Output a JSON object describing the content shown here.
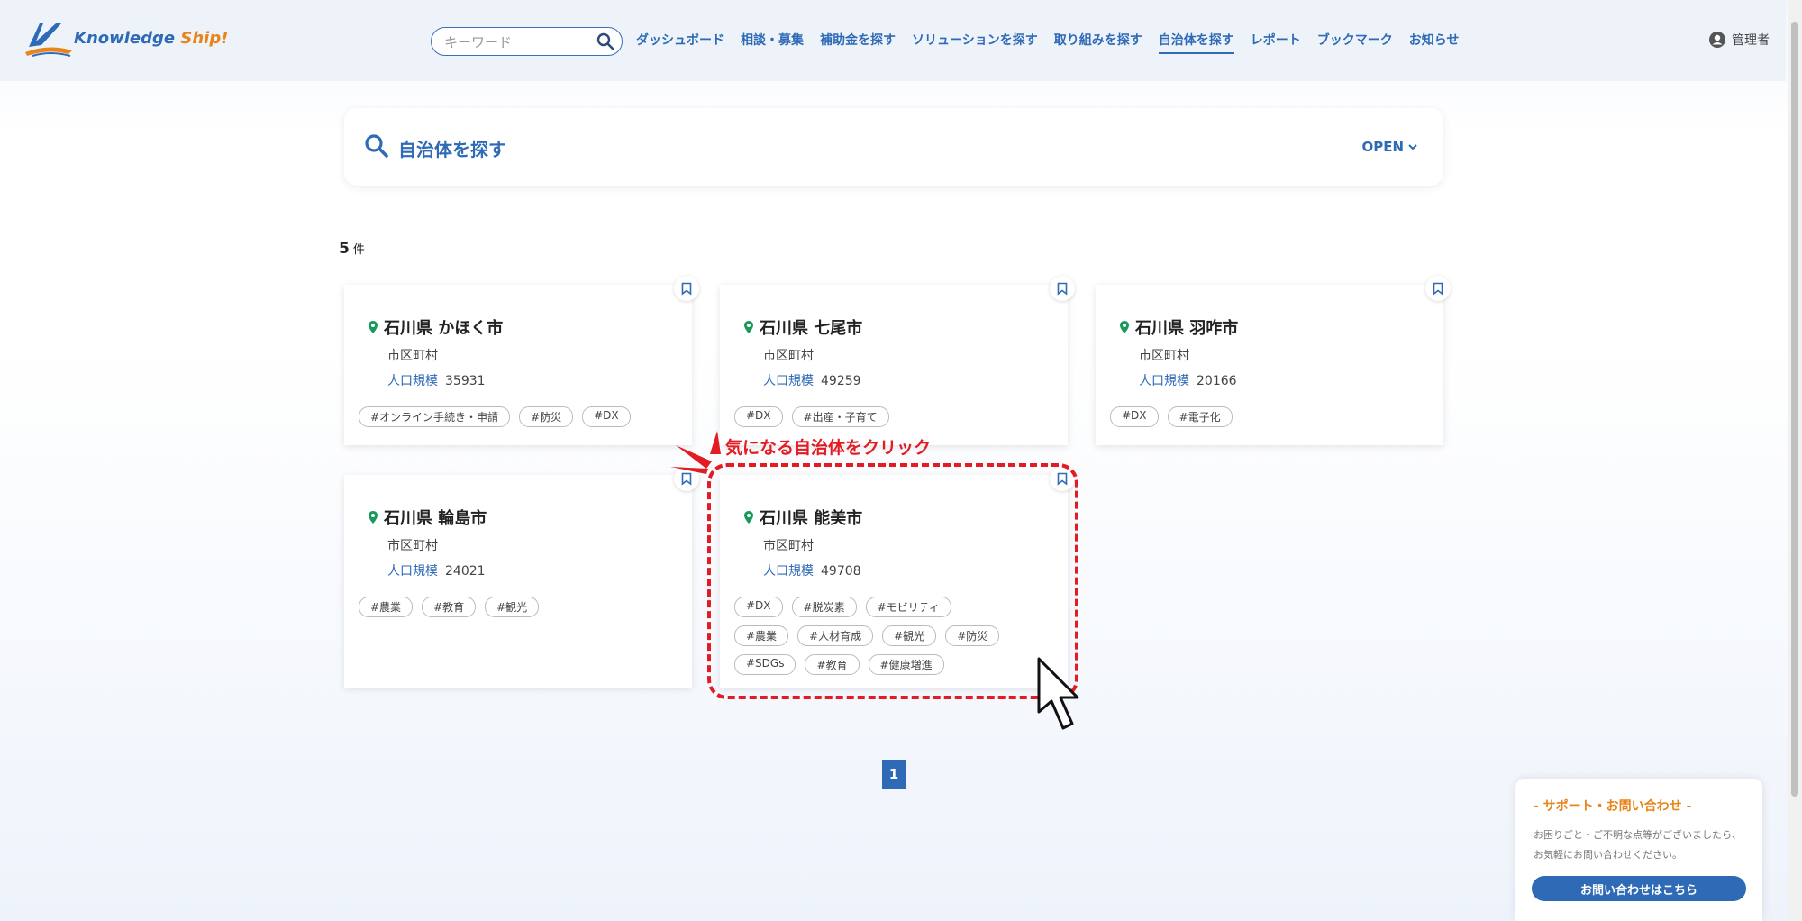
{
  "header": {
    "logo_text_main": "Knowledge ",
    "logo_text_accent": "Ship!",
    "search_placeholder": "キーワード",
    "nav": [
      {
        "label": "ダッシュボード"
      },
      {
        "label": "相談・募集"
      },
      {
        "label": "補助金を探す"
      },
      {
        "label": "ソリューションを探す"
      },
      {
        "label": "取り組みを探す"
      },
      {
        "label": "自治体を探す",
        "active": true
      },
      {
        "label": "レポート"
      },
      {
        "label": "ブックマーク"
      },
      {
        "label": "お知らせ"
      }
    ],
    "user_label": "管理者"
  },
  "filter": {
    "title": "自治体を探す",
    "toggle_label": "OPEN"
  },
  "results": {
    "count": "5",
    "count_unit": "件"
  },
  "cards": [
    {
      "title": "石川県 かほく市",
      "type": "市区町村",
      "population_label": "人口規模",
      "population": "35931",
      "tags": [
        "#オンライン手続き・申請",
        "#防災",
        "#DX"
      ]
    },
    {
      "title": "石川県 七尾市",
      "type": "市区町村",
      "population_label": "人口規模",
      "population": "49259",
      "tags": [
        "#DX",
        "#出産・子育て"
      ]
    },
    {
      "title": "石川県 羽咋市",
      "type": "市区町村",
      "population_label": "人口規模",
      "population": "20166",
      "tags": [
        "#DX",
        "#電子化"
      ]
    },
    {
      "title": "石川県 輪島市",
      "type": "市区町村",
      "population_label": "人口規模",
      "population": "24021",
      "tags": [
        "#農業",
        "#教育",
        "#観光"
      ]
    },
    {
      "title": "石川県 能美市",
      "type": "市区町村",
      "population_label": "人口規模",
      "population": "49708",
      "tags": [
        "#DX",
        "#脱炭素",
        "#モビリティ",
        "#農業",
        "#人材育成",
        "#観光",
        "#防災",
        "#SDGs",
        "#教育",
        "#健康増進"
      ]
    }
  ],
  "annotation": {
    "text": "気になる自治体をクリック"
  },
  "pagination": {
    "current": "1"
  },
  "support": {
    "title": "- サポート・お問い合わせ -",
    "body": "お困りごと・ご不明な点等がございましたら、お気軽にお問い合わせください。",
    "button": "お問い合わせはこちら"
  },
  "colors": {
    "primary": "#2e6ab5",
    "accent": "#e8841a",
    "annotation": "#e31b23",
    "pin": "#1a9a5a"
  }
}
